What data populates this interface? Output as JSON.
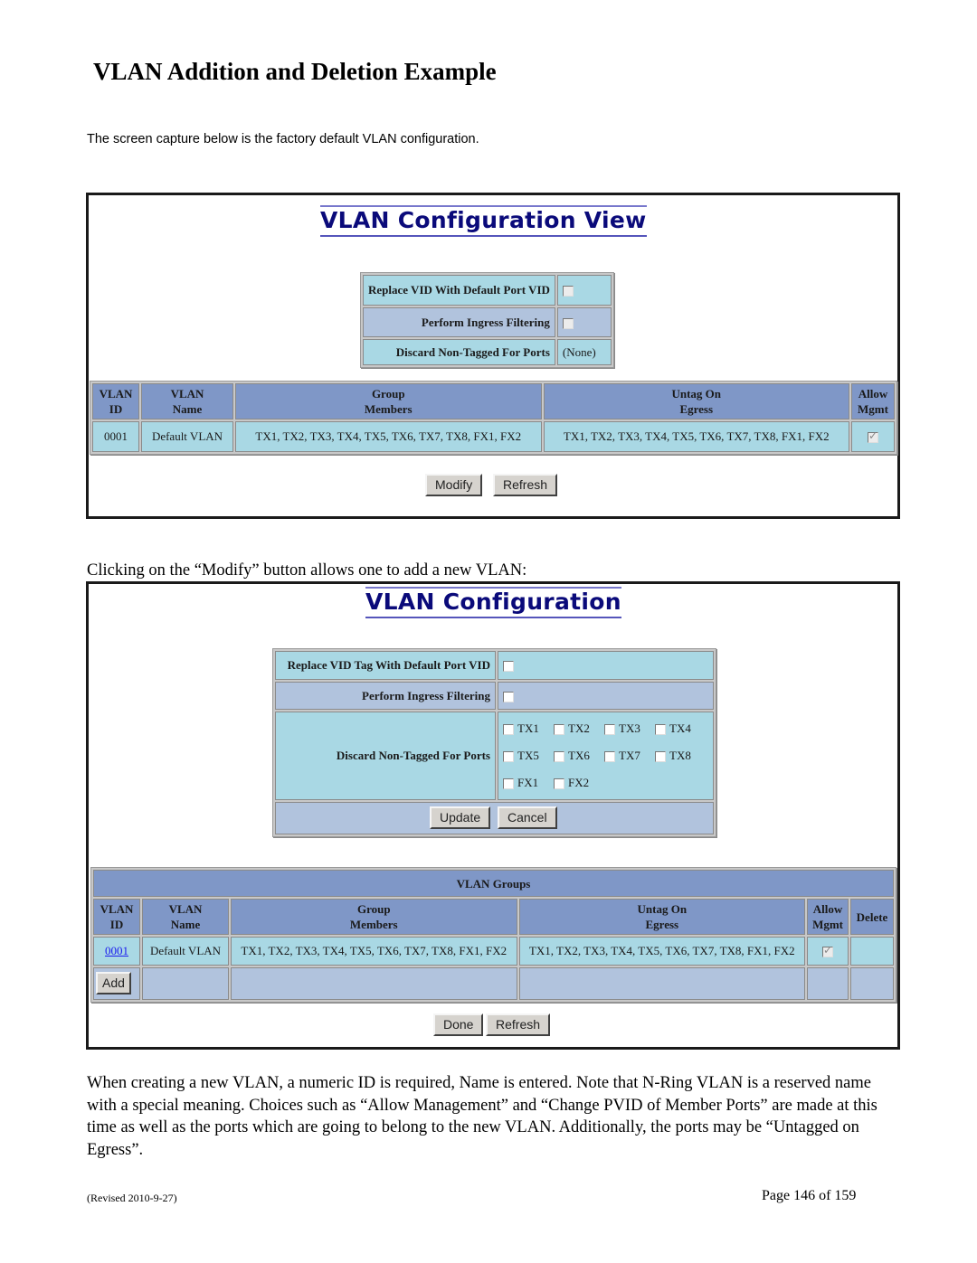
{
  "document": {
    "heading": "VLAN Addition and Deletion Example",
    "intro": "The screen capture below is the factory default VLAN configuration.",
    "caption_modify": "Clicking on the “Modify” button allows one to add a new VLAN:",
    "body_paragraph": "When creating a new VLAN, a numeric ID is required, Name is entered. Note that N-Ring VLAN is a reserved name with a special meaning. Choices such as “Allow Management” and “Change PVID of Member Ports” are made at this time as well as the ports which are going to belong to the new VLAN. Additionally, the ports may be “Untagged on Egress”.",
    "footer_revised": "(Revised 2010-9-27)",
    "footer_page": "Page 146 of 159"
  },
  "screen1": {
    "title": "VLAN Configuration View",
    "settings": [
      {
        "label": "Replace VID With Default Port VID",
        "type": "checkbox",
        "checked": false
      },
      {
        "label": "Perform Ingress Filtering",
        "type": "checkbox",
        "checked": false
      },
      {
        "label": "Discard Non-Tagged For Ports",
        "type": "text",
        "value": "(None)"
      }
    ],
    "table": {
      "headers": [
        {
          "line1": "VLAN",
          "line2": "ID"
        },
        {
          "line1": "VLAN",
          "line2": "Name"
        },
        {
          "line1": "Group",
          "line2": "Members"
        },
        {
          "line1": "Untag On",
          "line2": "Egress"
        },
        {
          "line1": "Allow",
          "line2": "Mgmt"
        }
      ],
      "rows": [
        {
          "id": "0001",
          "name": "Default VLAN",
          "members": "TX1, TX2, TX3, TX4, TX5, TX6, TX7, TX8, FX1, FX2",
          "untag": "TX1, TX2, TX3, TX4, TX5, TX6, TX7, TX8, FX1, FX2",
          "allow_mgmt": true
        }
      ]
    },
    "buttons": {
      "modify": "Modify",
      "refresh": "Refresh"
    }
  },
  "screen2": {
    "title": "VLAN Configuration",
    "settings": [
      {
        "label": "Replace VID Tag With Default Port VID",
        "checked": false
      },
      {
        "label": "Perform Ingress Filtering",
        "checked": false
      }
    ],
    "discard_label": "Discard Non-Tagged For Ports",
    "ports": [
      "TX1",
      "TX2",
      "TX3",
      "TX4",
      "TX5",
      "TX6",
      "TX7",
      "TX8",
      "FX1",
      "FX2"
    ],
    "buttons": {
      "update": "Update",
      "cancel": "Cancel",
      "add": "Add",
      "done": "Done",
      "refresh": "Refresh"
    },
    "groups": {
      "title": "VLAN Groups",
      "headers": [
        {
          "line1": "VLAN",
          "line2": "ID"
        },
        {
          "line1": "VLAN",
          "line2": "Name"
        },
        {
          "line1": "Group",
          "line2": "Members"
        },
        {
          "line1": "Untag On",
          "line2": "Egress"
        },
        {
          "line1": "Allow",
          "line2": "Mgmt"
        },
        {
          "line1": "Delete",
          "line2": ""
        }
      ],
      "rows": [
        {
          "id": "0001",
          "name": "Default VLAN",
          "members": "TX1, TX2, TX3, TX4, TX5, TX6, TX7, TX8, FX1, FX2",
          "untag": "TX1, TX2, TX3, TX4, TX5, TX6, TX7, TX8, FX1, FX2",
          "allow_mgmt": true
        }
      ]
    }
  },
  "colors": {
    "title_blue": "#0a0a7a",
    "header_blue": "#7f97c7",
    "row_cyan": "#a9d8e4",
    "row_lavender": "#b1c3dd",
    "link_blue": "#1a1aee"
  }
}
